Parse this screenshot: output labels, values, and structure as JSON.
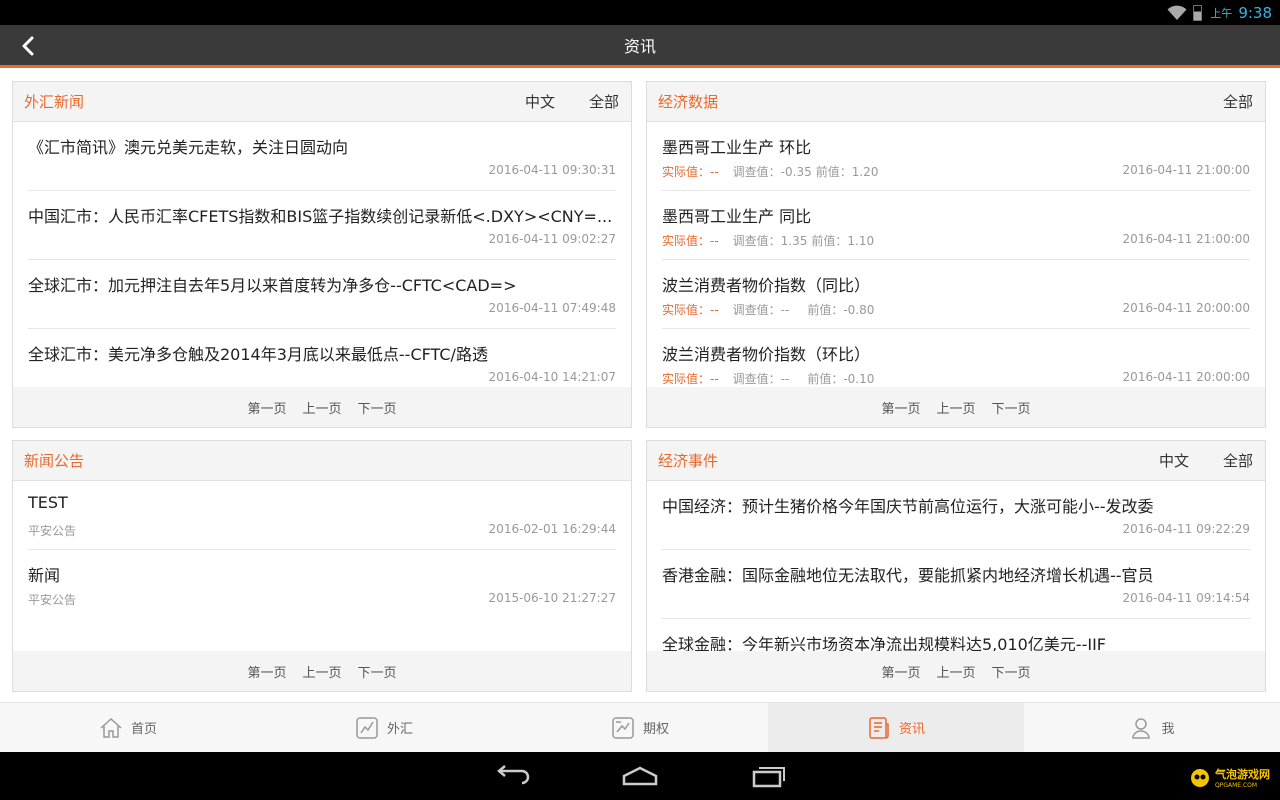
{
  "status_bar": {
    "ampm": "上午",
    "time": "9:38"
  },
  "title_bar": {
    "title": "资讯"
  },
  "forex_news": {
    "title": "外汇新闻",
    "filters": [
      "中文",
      "全部"
    ],
    "items": [
      {
        "title": "《汇市简讯》澳元兑美元走软，关注日圆动向",
        "date": "2016-04-11 09:30:31"
      },
      {
        "title": "中国汇市：人民币汇率CFETS指数和BIS篮子指数续创记录新低<.DXY><CNY=...",
        "date": "2016-04-11 09:02:27"
      },
      {
        "title": "全球汇市：加元押注自去年5月以来首度转为净多仓--CFTC<CAD=>",
        "date": "2016-04-11 07:49:48"
      },
      {
        "title": "全球汇市：美元净多仓触及2014年3月底以来最低点--CFTC/路透",
        "date": "2016-04-10 14:21:07"
      }
    ],
    "pager": [
      "第一页",
      "上一页",
      "下一页"
    ]
  },
  "econ_data": {
    "title": "经济数据",
    "filters": [
      "全部"
    ],
    "items": [
      {
        "title": "墨西哥工业生产 环比",
        "actual": "实际值：--",
        "expected": "调查值：-0.35",
        "previous": "前值：1.20",
        "date": "2016-04-11 21:00:00"
      },
      {
        "title": "墨西哥工业生产 同比",
        "actual": "实际值：--",
        "expected": "调查值：1.35",
        "previous": "前值：1.10",
        "date": "2016-04-11 21:00:00"
      },
      {
        "title": "波兰消费者物价指数（同比）",
        "actual": "实际值：--",
        "expected": "调查值：--",
        "previous": "前值：-0.80",
        "date": "2016-04-11 20:00:00"
      },
      {
        "title": "波兰消费者物价指数（环比）",
        "actual": "实际值：--",
        "expected": "调查值：--",
        "previous": "前值：-0.10",
        "date": "2016-04-11 20:00:00"
      }
    ],
    "pager": [
      "第一页",
      "上一页",
      "下一页"
    ]
  },
  "announcements": {
    "title": "新闻公告",
    "items": [
      {
        "title": "TEST",
        "source": "平安公告",
        "date": "2016-02-01 16:29:44"
      },
      {
        "title": "新闻",
        "source": "平安公告",
        "date": "2015-06-10 21:27:27"
      }
    ],
    "pager": [
      "第一页",
      "上一页",
      "下一页"
    ]
  },
  "econ_events": {
    "title": "经济事件",
    "filters": [
      "中文",
      "全部"
    ],
    "items": [
      {
        "title": "中国经济：预计生猪价格今年国庆节前高位运行，大涨可能小--发改委",
        "date": "2016-04-11 09:22:29"
      },
      {
        "title": "香港金融：国际金融地位无法取代，要能抓紧内地经济增长机遇--官员",
        "date": "2016-04-11 09:14:54"
      },
      {
        "title": "全球金融：今年新兴市场资本净流出规模料达5,010亿美元--IIF",
        "date": ""
      }
    ],
    "pager": [
      "第一页",
      "上一页",
      "下一页"
    ]
  },
  "tab_bar": {
    "tabs": [
      {
        "label": "首页",
        "icon": "home-icon"
      },
      {
        "label": "外汇",
        "icon": "chart-line-icon"
      },
      {
        "label": "期权",
        "icon": "options-chart-icon"
      },
      {
        "label": "资讯",
        "icon": "news-icon",
        "active": true
      },
      {
        "label": "我",
        "icon": "user-icon"
      }
    ]
  },
  "watermark": {
    "text": "气泡游戏网",
    "sub": "QPGAME.COM"
  },
  "colors": {
    "accent": "#e8692c",
    "titlebar": "#3a3a3a",
    "status_text": "#33b5e5"
  }
}
